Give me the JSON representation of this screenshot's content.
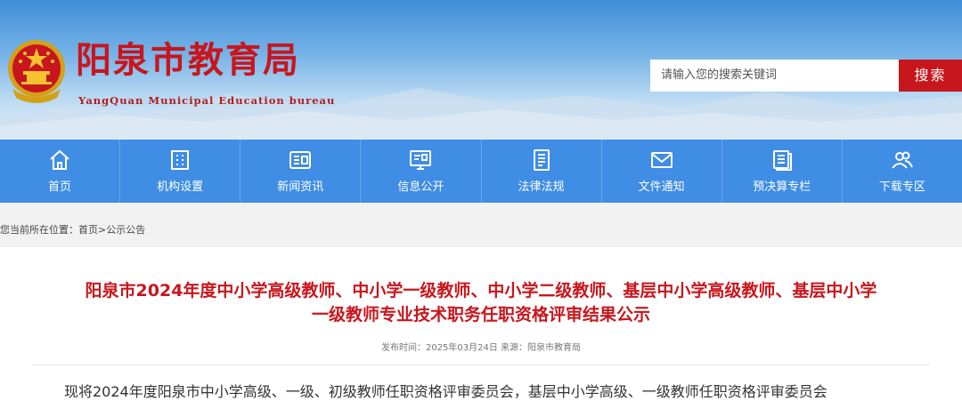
{
  "header": {
    "site_name": "阳泉市教育局",
    "site_subtitle": "YangQuan Municipal Education bureau",
    "emblem_icon": "national-emblem-icon"
  },
  "search": {
    "placeholder": "请输入您的搜索关键词",
    "button_label": "搜索"
  },
  "nav": {
    "items": [
      {
        "label": "首页",
        "icon": "home-icon"
      },
      {
        "label": "机构设置",
        "icon": "building-icon"
      },
      {
        "label": "新闻资讯",
        "icon": "news-icon"
      },
      {
        "label": "信息公开",
        "icon": "info-board-icon"
      },
      {
        "label": "法律法规",
        "icon": "law-document-icon"
      },
      {
        "label": "文件通知",
        "icon": "mail-icon"
      },
      {
        "label": "预决算专栏",
        "icon": "budget-icon"
      },
      {
        "label": "下载专区",
        "icon": "users-icon"
      }
    ]
  },
  "breadcrumb": {
    "prefix": "您当前所在位置：",
    "home": "首页",
    "separator": ">",
    "current": "公示公告"
  },
  "article": {
    "title_line1": "阳泉市2024年度中小学高级教师、中小学一级教师、中小学二级教师、基层中小学高级教师、基层中小学",
    "title_line2": "一级教师专业技术职务任职资格评审结果公示",
    "meta": "发布时间：2025年03月24日 来源：阳泉市教育局",
    "first_line": "现将2024年度阳泉市中小学高级、一级、初级教师任职资格评审委员会，基层中小学高级、一级教师任职资格评审委员会"
  },
  "colors": {
    "brand_red": "#c8161d",
    "nav_blue": "#3f8de4"
  }
}
